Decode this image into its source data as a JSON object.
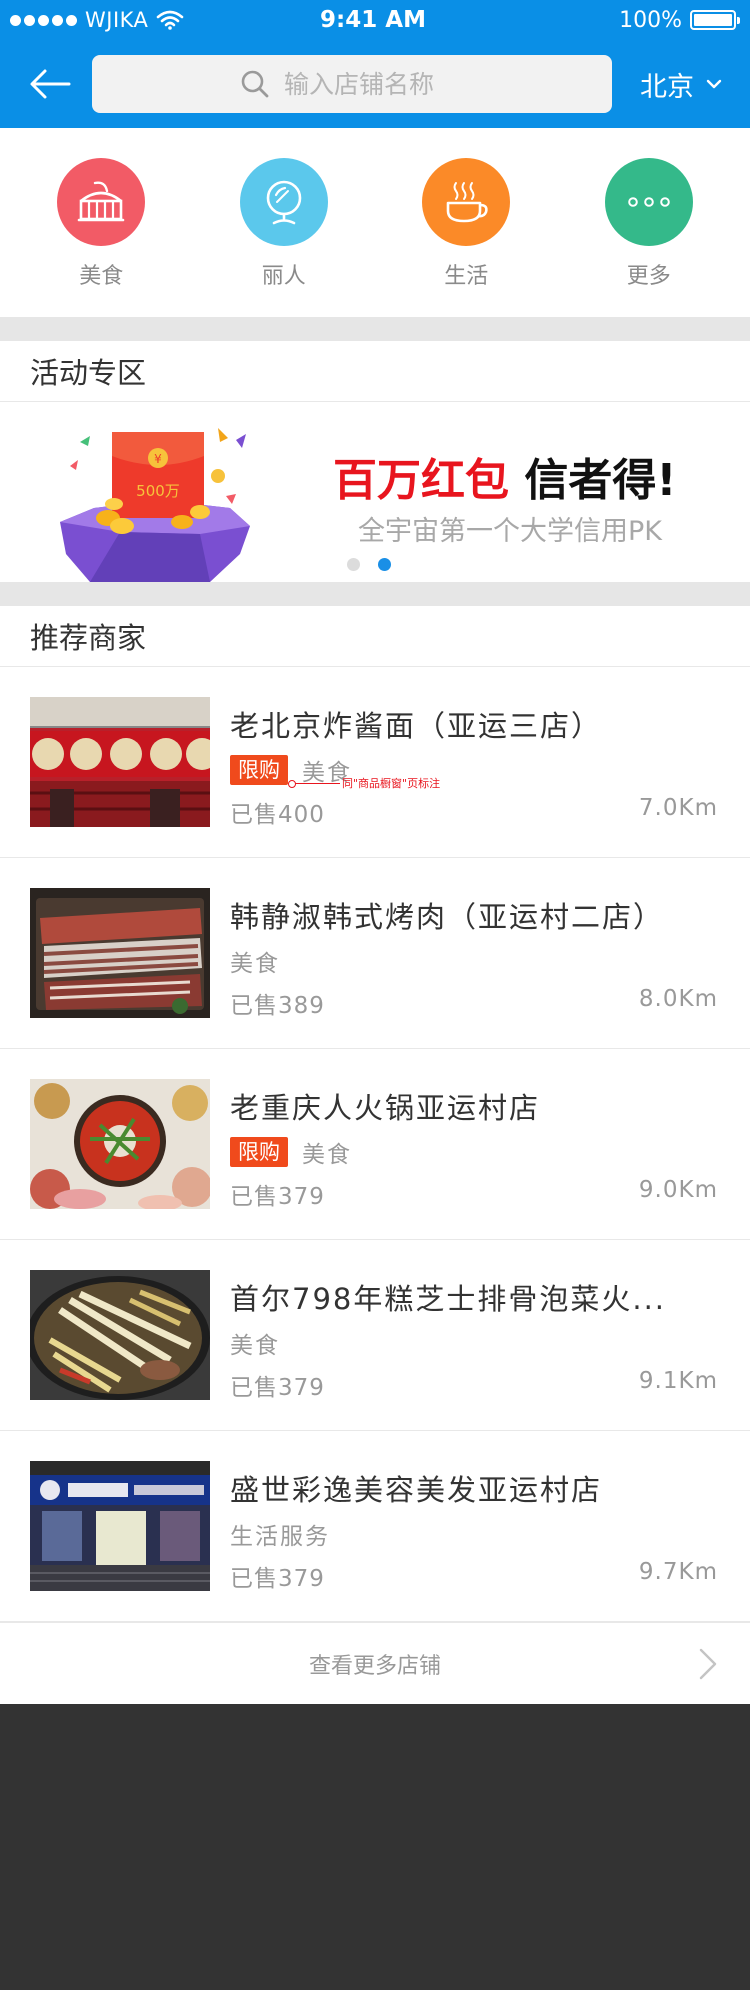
{
  "status_bar": {
    "carrier": "WJIKA",
    "time": "9:41 AM",
    "battery": "100%"
  },
  "nav": {
    "search_placeholder": "输入店铺名称",
    "city": "北京"
  },
  "categories": [
    {
      "label": "美食",
      "icon": "cake-icon",
      "color": "#f25b66"
    },
    {
      "label": "丽人",
      "icon": "mirror-icon",
      "color": "#5bc8ec"
    },
    {
      "label": "生活",
      "icon": "coffee-icon",
      "color": "#fb8a28"
    },
    {
      "label": "更多",
      "icon": "more-icon",
      "color": "#34b98a"
    }
  ],
  "activity": {
    "title": "活动专区",
    "banner": {
      "envelope_amount": "500万",
      "envelope_symbol": "¥",
      "title_highlight": "百万红包",
      "title_rest": "信者得!",
      "subtitle": "全宇宙第一个大学信用PK",
      "active_dot": 1
    }
  },
  "recommend": {
    "title": "推荐商家",
    "shops": [
      {
        "name": "老北京炸酱面（亚运三店）",
        "limited": "限购",
        "category": "美食",
        "sold": "已售400",
        "distance": "7.0Km",
        "annotation": "同\"商品橱窗\"页标注"
      },
      {
        "name": "韩静淑韩式烤肉（亚运村二店）",
        "limited": "",
        "category": "美食",
        "sold": "已售389",
        "distance": "8.0Km"
      },
      {
        "name": "老重庆人火锅亚运村店",
        "limited": "限购",
        "category": "美食",
        "sold": "已售379",
        "distance": "9.0Km"
      },
      {
        "name": "首尔798年糕芝士排骨泡菜火...",
        "limited": "",
        "category": "美食",
        "sold": "已售379",
        "distance": "9.1Km"
      },
      {
        "name": "盛世彩逸美容美发亚运村店",
        "limited": "",
        "category": "生活服务",
        "sold": "已售379",
        "distance": "9.7Km"
      }
    ],
    "more_label": "查看更多店铺"
  },
  "colors": {
    "primary": "#0a8fe6",
    "tag_red": "#f04a1c",
    "banner_red": "#e8151e"
  }
}
